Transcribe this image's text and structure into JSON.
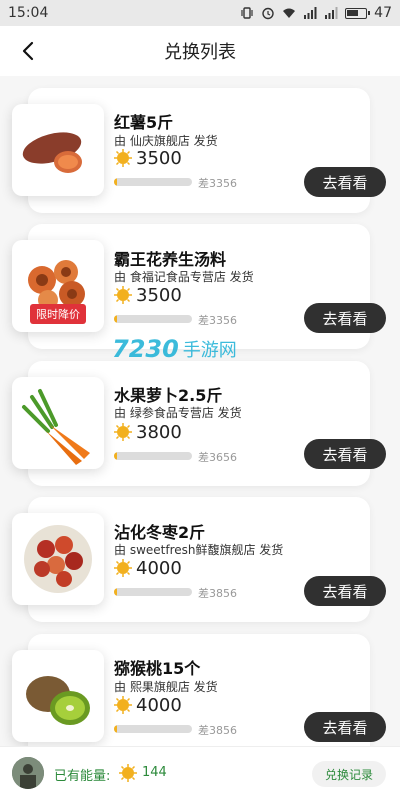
{
  "status_bar": {
    "time": "15:04",
    "battery": "47"
  },
  "header": {
    "title": "兑换列表"
  },
  "watermark": {
    "number": "7230",
    "text": "手游网"
  },
  "items": [
    {
      "name": "红薯5斤",
      "store": "由  仙庆旗舰店  发货",
      "price": "3500",
      "diff": "差3356",
      "progress": 0.04,
      "button": "去看看",
      "image": "sweet-potato"
    },
    {
      "name": "霸王花养生汤料",
      "store": "由  食福记食品专营店  发货",
      "price": "3500",
      "diff": "差3356",
      "progress": 0.04,
      "button": "去看看",
      "image": "abalone",
      "badge": "限时降价"
    },
    {
      "name": "水果萝卜2.5斤",
      "store": "由  绿参食品专营店  发货",
      "price": "3800",
      "diff": "差3656",
      "progress": 0.04,
      "button": "去看看",
      "image": "carrot"
    },
    {
      "name": "沾化冬枣2斤",
      "store": "由  sweetfresh鲜馥旗舰店  发货",
      "price": "4000",
      "diff": "差3856",
      "progress": 0.04,
      "button": "去看看",
      "image": "jujube"
    },
    {
      "name": "猕猴桃15个",
      "store": "由  熙果旗舰店  发货",
      "price": "4000",
      "diff": "差3856",
      "progress": 0.04,
      "button": "去看看",
      "image": "kiwi"
    }
  ],
  "bottom_bar": {
    "energy_label": "已有能量:",
    "energy_value": "144",
    "records_button": "兑换记录"
  },
  "colors": {
    "button_bg": "#303030",
    "progress_fill": "#f2b01e",
    "accent_green": "#2c8a3b",
    "watermark": "#27b4d8"
  }
}
